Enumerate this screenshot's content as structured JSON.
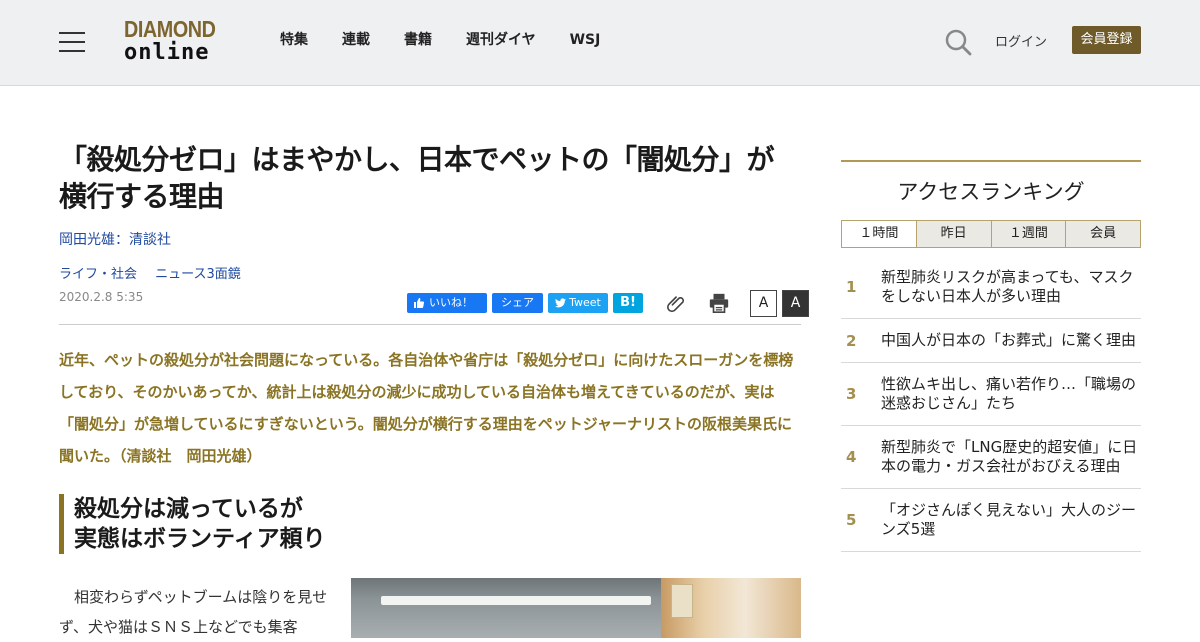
{
  "header": {
    "logo_line1": "DIAMOND",
    "logo_line2": "online",
    "nav": [
      "特集",
      "連載",
      "書籍",
      "週刊ダイヤ",
      "WSJ"
    ],
    "login_label": "ログイン",
    "register_label": "会員登録"
  },
  "article": {
    "title": "「殺処分ゼロ」はまやかし、日本でペットの「闇処分」が横行する理由",
    "author": "岡田光雄：清談社",
    "categories": [
      "ライフ・社会",
      "ニュース3面鏡"
    ],
    "date": "2020.2.8 5:35",
    "share": {
      "like_label": "いいね！",
      "share_label": "シェア",
      "tweet_label": "Tweet",
      "hatena_label": "B!"
    },
    "font_small_label": "A",
    "font_large_label": "A",
    "lead": "近年、ペットの殺処分が社会問題になっている。各自治体や省庁は「殺処分ゼロ」に向けたスローガンを標榜しており、そのかいあってか、統計上は殺処分の減少に成功している自治体も増えてきているのだが、実は「闇処分」が急増しているにすぎないという。闇処分が横行する理由をペットジャーナリストの阪根美果氏に聞いた。（清談社　岡田光雄）",
    "heading_line1": "殺処分は減っているが",
    "heading_line2": "実態はボランティア頼り",
    "body": "　相変わらずペットブームは陰りを見せず、犬や猫はＳＮＳ上などでも集客"
  },
  "sidebar": {
    "title": "アクセスランキング",
    "tabs": [
      "１時間",
      "昨日",
      "１週間",
      "会員"
    ],
    "ranking": [
      {
        "rank": "1",
        "text": "新型肺炎リスクが高まっても、マスクをしない日本人が多い理由"
      },
      {
        "rank": "2",
        "text": "中国人が日本の「お葬式」に驚く理由"
      },
      {
        "rank": "3",
        "text": "性欲ムキ出し、痛い若作り…「職場の迷惑おじさん」たち"
      },
      {
        "rank": "4",
        "text": "新型肺炎で「LNG歴史的超安値」に日本の電力・ガス会社がおびえる理由"
      },
      {
        "rank": "5",
        "text": "「オジさんぽく見えない」大人のジーンズ5選"
      }
    ]
  }
}
